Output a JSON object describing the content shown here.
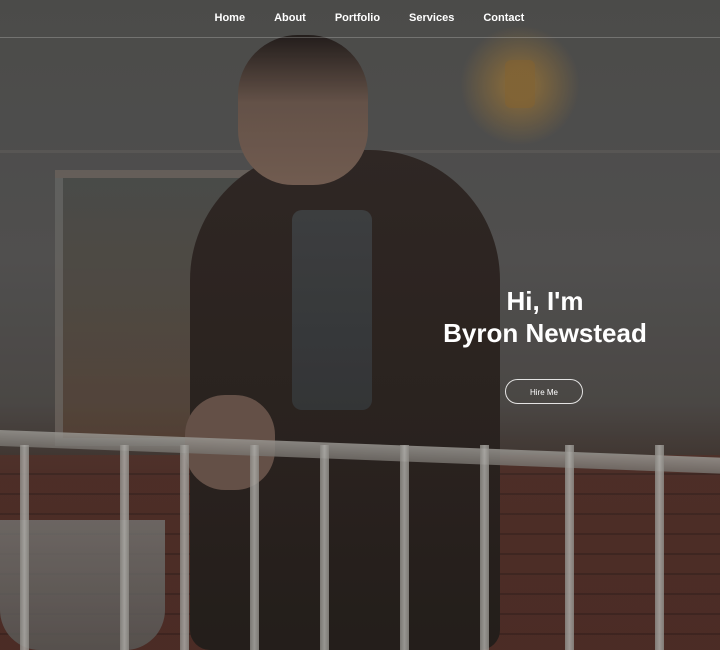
{
  "nav": {
    "items": [
      {
        "label": "Home"
      },
      {
        "label": "About"
      },
      {
        "label": "Portfolio"
      },
      {
        "label": "Services"
      },
      {
        "label": "Contact"
      }
    ]
  },
  "hero": {
    "greeting": "Hi, I'm",
    "name": "Byron Newstead",
    "hire_label": "Hire Me"
  },
  "colors": {
    "text": "#ffffff",
    "overlay": "rgba(0,0,0,0.18)"
  }
}
